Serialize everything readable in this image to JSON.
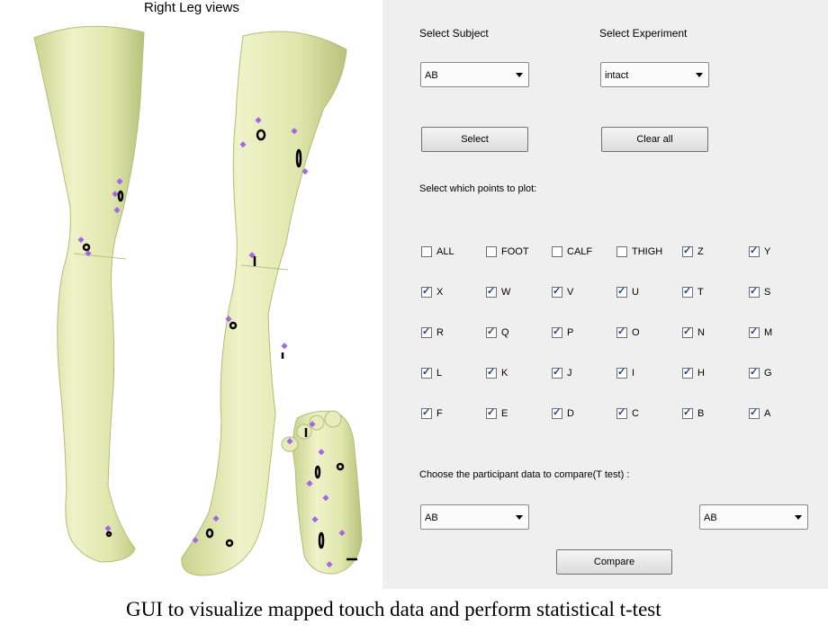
{
  "leg_views": {
    "title": "Right Leg views"
  },
  "panel": {
    "subject_label": "Select Subject",
    "experiment_label": "Select Experiment",
    "subject_value": "AB",
    "experiment_value": "intact",
    "select_button": "Select",
    "clear_button": "Clear all",
    "points_label": "Select which points to plot:",
    "checkboxes": [
      {
        "label": "ALL",
        "checked": false
      },
      {
        "label": "FOOT",
        "checked": false
      },
      {
        "label": "CALF",
        "checked": false
      },
      {
        "label": "THIGH",
        "checked": false
      },
      {
        "label": "Z",
        "checked": true
      },
      {
        "label": "Y",
        "checked": true
      },
      {
        "label": "X",
        "checked": true
      },
      {
        "label": "W",
        "checked": true
      },
      {
        "label": "V",
        "checked": true
      },
      {
        "label": "U",
        "checked": true
      },
      {
        "label": "T",
        "checked": true
      },
      {
        "label": "S",
        "checked": true
      },
      {
        "label": "R",
        "checked": true
      },
      {
        "label": "Q",
        "checked": true
      },
      {
        "label": "P",
        "checked": true
      },
      {
        "label": "O",
        "checked": true
      },
      {
        "label": "N",
        "checked": true
      },
      {
        "label": "M",
        "checked": true
      },
      {
        "label": "L",
        "checked": true
      },
      {
        "label": "K",
        "checked": true
      },
      {
        "label": "J",
        "checked": true
      },
      {
        "label": "I",
        "checked": true
      },
      {
        "label": "H",
        "checked": true
      },
      {
        "label": "G",
        "checked": true
      },
      {
        "label": "F",
        "checked": true
      },
      {
        "label": "E",
        "checked": true
      },
      {
        "label": "D",
        "checked": true
      },
      {
        "label": "C",
        "checked": true
      },
      {
        "label": "B",
        "checked": true
      },
      {
        "label": "A",
        "checked": true
      }
    ],
    "compare_label": "Choose the participant data to compare(T test) :",
    "compare_left_value": "AB",
    "compare_right_value": "AB",
    "compare_button": "Compare"
  },
  "caption": "GUI to visualize mapped touch data and perform statistical t-test",
  "colors": {
    "leg": "#dfe7ad",
    "leg_shade": "#c5d08a",
    "marker": "#a566e6",
    "panel": "#efefef"
  }
}
